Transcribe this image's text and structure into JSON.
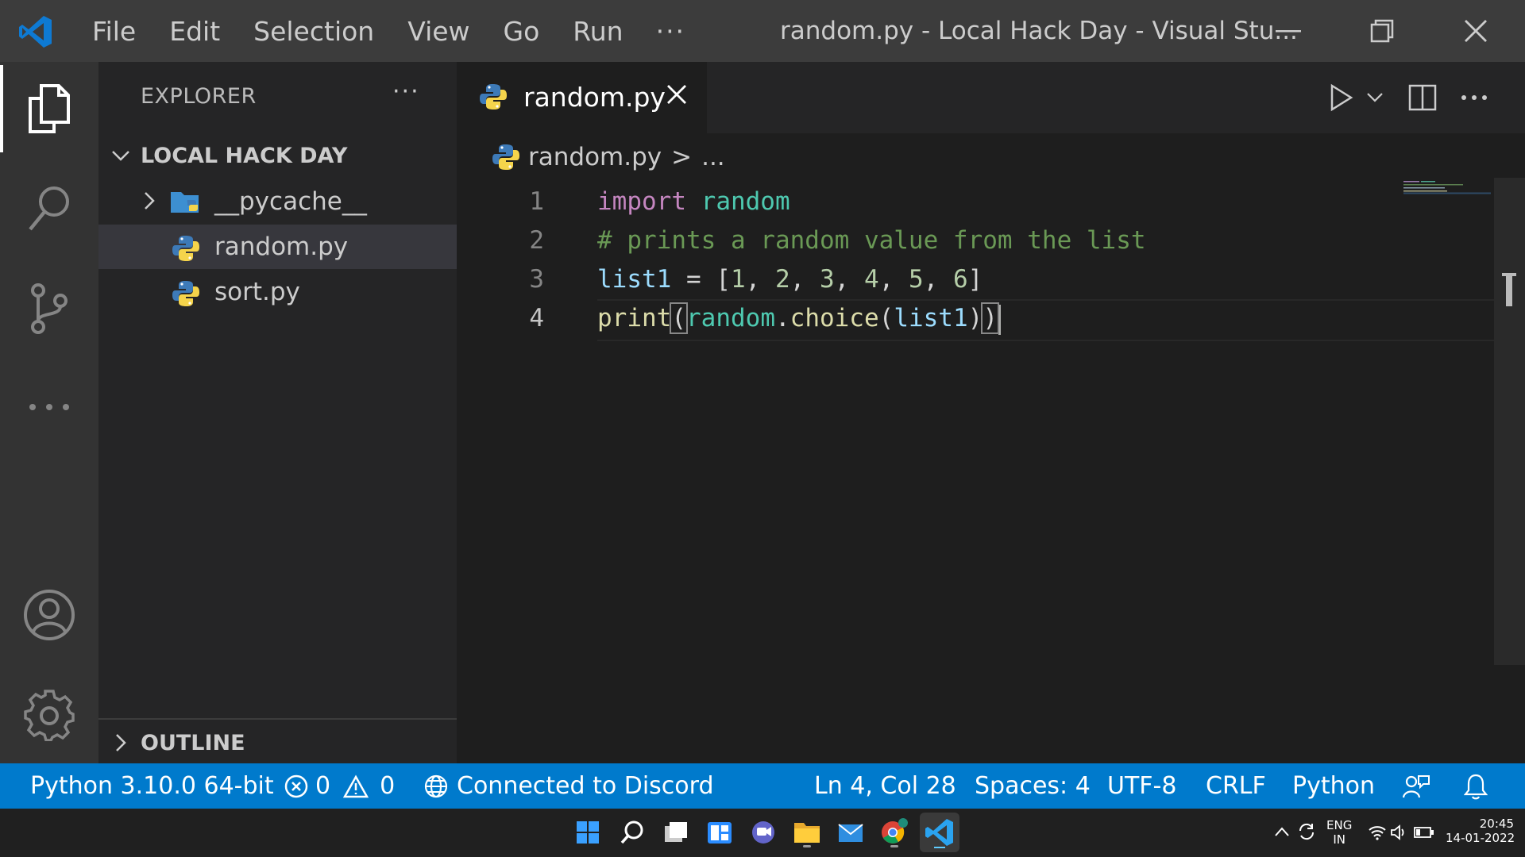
{
  "titlebar": {
    "menu": [
      "File",
      "Edit",
      "Selection",
      "View",
      "Go",
      "Run"
    ],
    "more": "···",
    "title": "random.py - Local Hack Day - Visual Stu..."
  },
  "sidebar": {
    "title": "EXPLORER",
    "more": "···",
    "workspace": "LOCAL HACK DAY",
    "items": [
      {
        "name": "__pycache__",
        "type": "folder"
      },
      {
        "name": "random.py",
        "type": "python",
        "selected": true
      },
      {
        "name": "sort.py",
        "type": "python"
      }
    ],
    "outline": "OUTLINE"
  },
  "editor": {
    "tab": {
      "name": "random.py"
    },
    "breadcrumb": {
      "file": "random.py",
      "sep": ">",
      "rest": "..."
    },
    "lines": [
      {
        "n": "1",
        "text": "import random"
      },
      {
        "n": "2",
        "text": "# prints a random value from the list"
      },
      {
        "n": "3",
        "text": "list1 = [1, 2, 3, 4, 5, 6]"
      },
      {
        "n": "4",
        "text": "print(random.choice(list1))"
      }
    ]
  },
  "statusbar": {
    "interpreter": "Python 3.10.0 64-bit",
    "errors": "0",
    "warnings": "0",
    "discord": "Connected to Discord",
    "position": "Ln 4, Col 28",
    "spaces": "Spaces: 4",
    "encoding": "UTF-8",
    "eol": "CRLF",
    "language": "Python"
  },
  "taskbar": {
    "lang_top": "ENG",
    "lang_bottom": "IN",
    "time": "20:45",
    "date": "14-01-2022"
  },
  "colors": {
    "accent": "#007acc",
    "keyword": "#c586c0",
    "module": "#4ec9b0",
    "comment": "#6a9955",
    "variable": "#9cdcfe",
    "function": "#dcdcaa",
    "number": "#b5cea8"
  }
}
